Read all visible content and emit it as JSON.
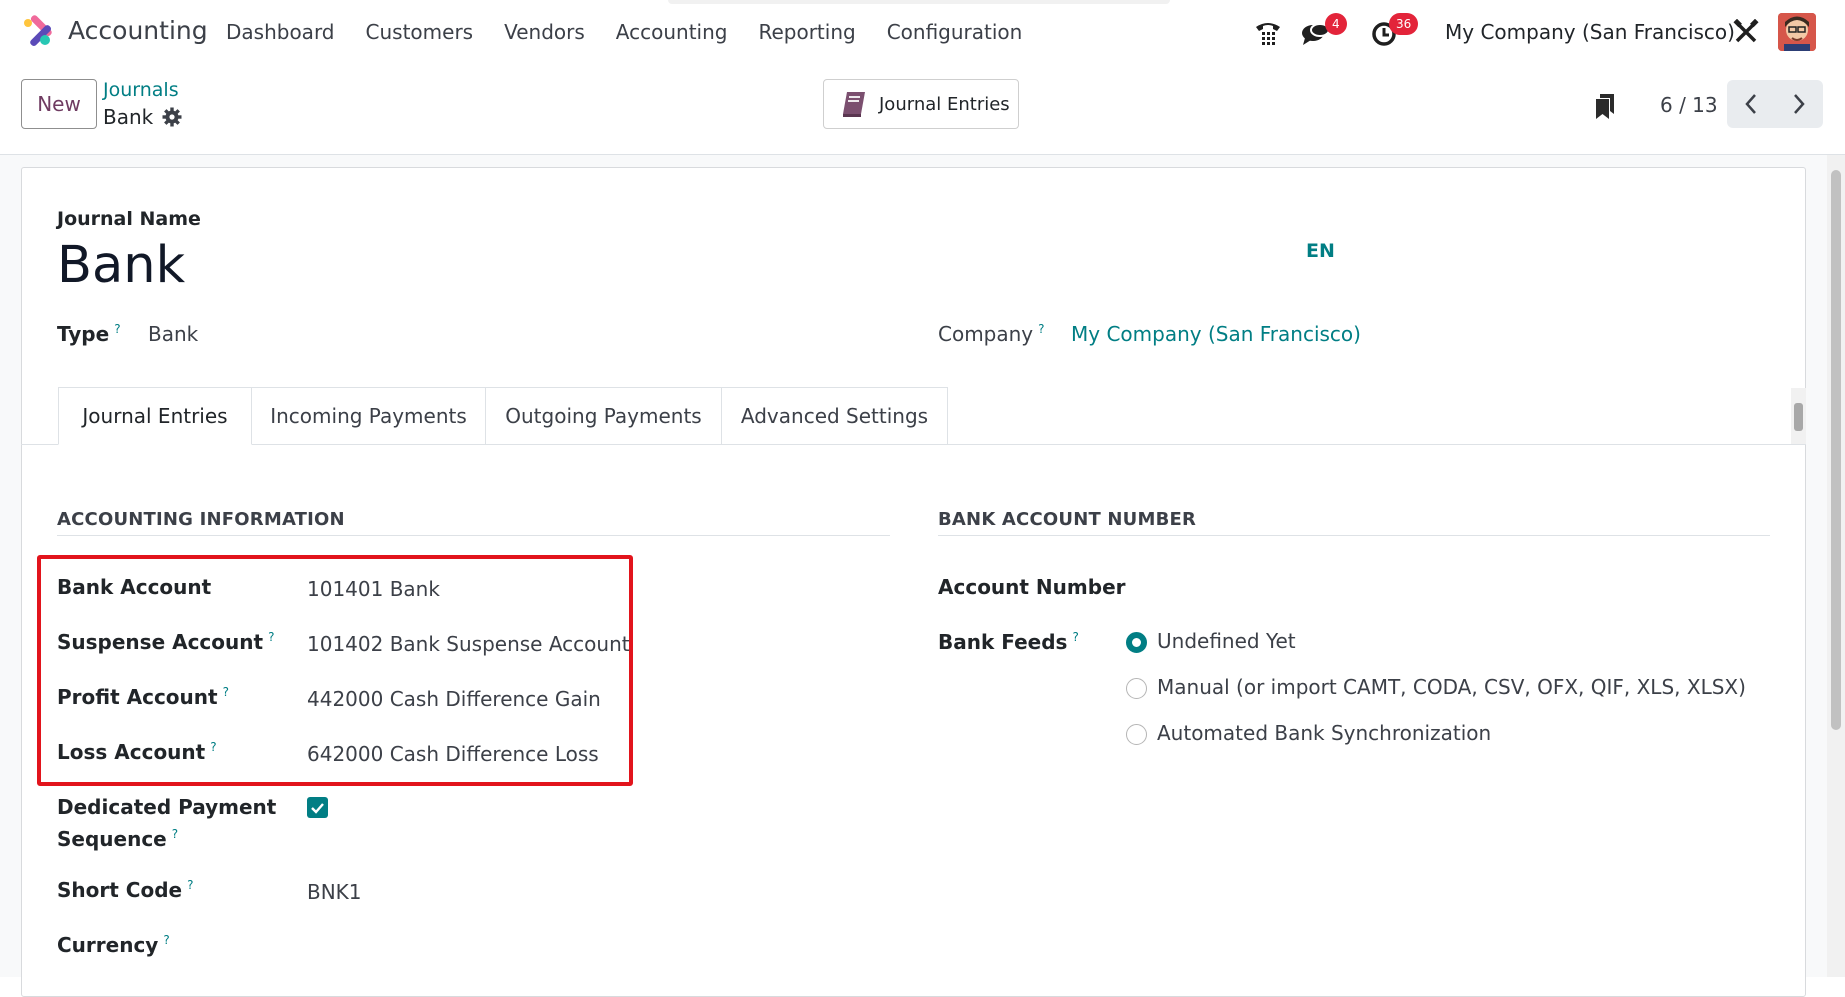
{
  "navbar": {
    "app_name": "Accounting",
    "menu": [
      "Dashboard",
      "Customers",
      "Vendors",
      "Accounting",
      "Reporting",
      "Configuration"
    ],
    "messages_badge": "4",
    "activities_badge": "36",
    "company": "My Company (San Francisco)",
    "brand_color": "#714b67",
    "accent_color": "#017e84"
  },
  "control_panel": {
    "new_label": "New",
    "breadcrumb_parent": "Journals",
    "breadcrumb_current": "Bank",
    "smart_button_label": "Journal Entries",
    "pager": "6 / 13"
  },
  "form": {
    "journal_name_label": "Journal Name",
    "journal_name": "Bank",
    "lang": "EN",
    "type_label": "Type",
    "type_value": "Bank",
    "company_label": "Company",
    "company_value": "My Company (San Francisco)",
    "tabs": [
      "Journal Entries",
      "Incoming Payments",
      "Outgoing Payments",
      "Advanced Settings"
    ],
    "accounting": {
      "title": "ACCOUNTING INFORMATION",
      "bank_account_label": "Bank Account",
      "bank_account": "101401 Bank",
      "suspense_label": "Suspense Account",
      "suspense": "101402 Bank Suspense Account",
      "profit_label": "Profit Account",
      "profit": "442000 Cash Difference Gain",
      "loss_label": "Loss Account",
      "loss": "642000 Cash Difference Loss",
      "dedicated_label_1": "Dedicated Payment",
      "dedicated_label_2": "Sequence",
      "dedicated_checked": true,
      "short_code_label": "Short Code",
      "short_code": "BNK1",
      "currency_label": "Currency"
    },
    "bank_account_number": {
      "title": "BANK ACCOUNT NUMBER",
      "account_number_label": "Account Number",
      "bank_feeds_label": "Bank Feeds",
      "bank_feeds_options": [
        "Undefined Yet",
        "Manual (or import CAMT, CODA, CSV, OFX, QIF, XLS, XLSX)",
        "Automated Bank Synchronization"
      ],
      "bank_feeds_selected": "Undefined Yet"
    }
  }
}
